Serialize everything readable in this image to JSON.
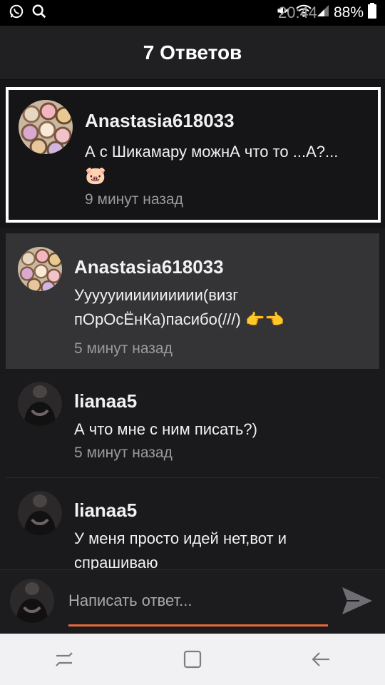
{
  "status_bar": {
    "battery": "88%",
    "time": "20:44",
    "icons": [
      "whatsapp-icon",
      "search-icon",
      "mute-icon",
      "wifi-icon",
      "signal-icon",
      "battery-icon"
    ]
  },
  "header": {
    "title": "7 Ответов"
  },
  "parent_comment": {
    "username": "Anastasia618033",
    "message_line1": "А с Шикамару можнА что то ...А?...",
    "emoji": "🐷",
    "time": "9 минут назад"
  },
  "replies": [
    {
      "username": "Anastasia618033",
      "line1": "Уууууииииииииии(визг",
      "line2": "пОрОсЁнКа)пасибо(///) 👉👈",
      "time": "5 минут назад"
    },
    {
      "username": "lianaa5",
      "line1": "А что мне с ним писать?)",
      "time": "5 минут назад"
    },
    {
      "username": "lianaa5",
      "line1": "У меня просто идей нет,вот и",
      "line2": "спрашиваю"
    }
  ],
  "composer": {
    "placeholder": "Написать ответ..."
  },
  "colors": {
    "accent": "#e86a3a",
    "background": "#151417",
    "highlight": "#343336"
  }
}
